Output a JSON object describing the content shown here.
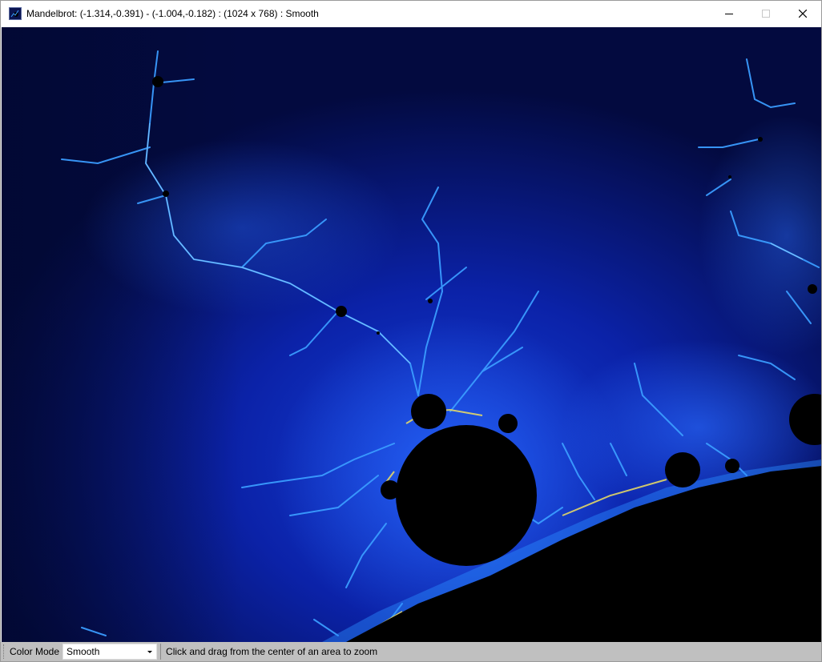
{
  "window": {
    "title": "Mandelbrot: (-1.314,-0.391) - (-1.004,-0.182) : (1024 x 768) : Smooth",
    "minimize_icon": "minimize-icon",
    "maximize_icon": "maximize-icon",
    "close_icon": "close-icon"
  },
  "canvas": {
    "description_icon": "fractal-image",
    "colors": {
      "background": "#030a3f",
      "glow": "#1e5cff",
      "filament": "#3aa0ff",
      "set": "#000000",
      "edge": "#f0e060"
    }
  },
  "statusbar": {
    "color_mode_label": "Color Mode",
    "color_mode_value": "Smooth",
    "hint": "Click and drag from the center of an area to zoom"
  }
}
